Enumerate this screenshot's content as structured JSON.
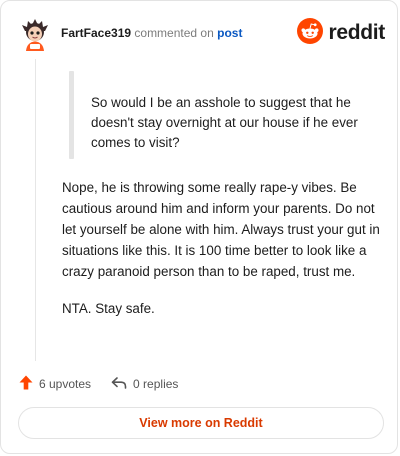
{
  "header": {
    "username": "FartFace319",
    "action_text": "commented on",
    "post_link": "post",
    "brand": "reddit"
  },
  "quote": {
    "text": "So would I be an asshole to suggest that he doesn't stay overnight at our house if he ever comes to visit?"
  },
  "comment": {
    "paragraphs": [
      "Nope, he is throwing some really rape-y vibes. Be cautious around him and inform your parents. Do not let yourself be alone with him. Always trust your gut in situations like this. It is 100 time better to look like a crazy paranoid person than to be raped, trust me.",
      "NTA. Stay safe."
    ]
  },
  "actions": {
    "upvotes": "6 upvotes",
    "replies": "0 replies"
  },
  "footer": {
    "view_more": "View more on Reddit"
  },
  "colors": {
    "brand": "#ff4500",
    "link": "#0a58c2",
    "cta": "#d93a00"
  },
  "icons": [
    "avatar",
    "reddit-logo-icon",
    "upvote-arrow-icon",
    "reply-arrow-icon"
  ]
}
